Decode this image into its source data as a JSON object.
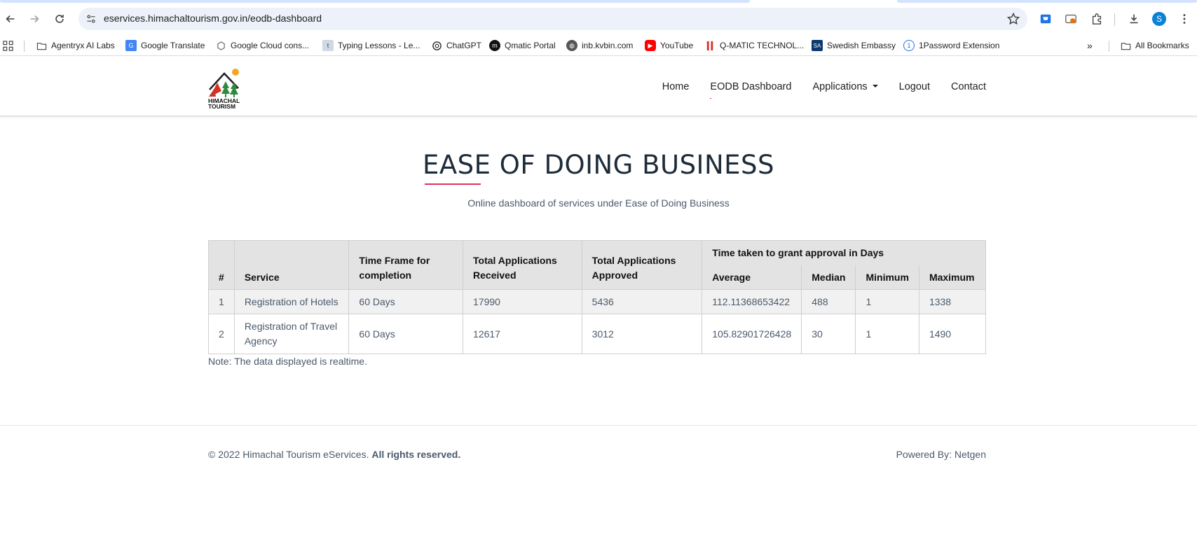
{
  "browser": {
    "url": "eservices.himachaltourism.gov.in/eodb-dashboard",
    "profile_initial": "S",
    "bookmarks": [
      {
        "label": "Agentryx AI Labs",
        "icon": "folder-icon"
      },
      {
        "label": "Google Translate",
        "icon": "google-translate-icon"
      },
      {
        "label": "Google Cloud cons...",
        "icon": "google-cloud-icon"
      },
      {
        "label": "Typing Lessons - Le...",
        "icon": "typing-icon"
      },
      {
        "label": "ChatGPT",
        "icon": "chatgpt-icon"
      },
      {
        "label": "Qmatic Portal",
        "icon": "qmatic-icon"
      },
      {
        "label": "inb.kvbin.com",
        "icon": "globe-icon"
      },
      {
        "label": "YouTube",
        "icon": "youtube-icon"
      },
      {
        "label": "Q-MATIC TECHNOL...",
        "icon": "qmatic-tech-icon"
      },
      {
        "label": "Swedish Embassy",
        "icon": "sa-icon"
      },
      {
        "label": "1Password Extension",
        "icon": "1password-icon"
      }
    ],
    "all_bookmarks_label": "All Bookmarks"
  },
  "header": {
    "logo_text": [
      "HIMACHAL",
      "TOURISM"
    ],
    "nav": [
      {
        "label": "Home"
      },
      {
        "label": "EODB Dashboard"
      },
      {
        "label": "Applications"
      },
      {
        "label": "Logout"
      },
      {
        "label": "Contact"
      }
    ]
  },
  "main": {
    "title": "EASE OF DOING BUSINESS",
    "subtitle": "Online dashboard of services under Ease of Doing Business",
    "table": {
      "headers": {
        "index": "#",
        "service": "Service",
        "time_frame": "Time Frame for completion",
        "received": "Total Applications Received",
        "approved": "Total Applications Approved",
        "group": "Time taken to grant approval in Days",
        "average": "Average",
        "median": "Median",
        "minimum": "Minimum",
        "maximum": "Maximum"
      },
      "rows": [
        {
          "index": "1",
          "service": "Registration of Hotels",
          "time_frame": "60 Days",
          "received": "17990",
          "approved": "5436",
          "average": "112.11368653422",
          "median": "488",
          "minimum": "1",
          "maximum": "1338"
        },
        {
          "index": "2",
          "service": "Registration of Travel Agency",
          "time_frame": "60 Days",
          "received": "12617",
          "approved": "3012",
          "average": "105.82901726428",
          "median": "30",
          "minimum": "1",
          "maximum": "1490"
        }
      ]
    },
    "note": "Note: The data displayed is realtime."
  },
  "footer": {
    "copyright": "© 2022 Himachal Tourism eServices.",
    "rights": "All rights reserved.",
    "powered_by": "Powered By: Netgen"
  }
}
